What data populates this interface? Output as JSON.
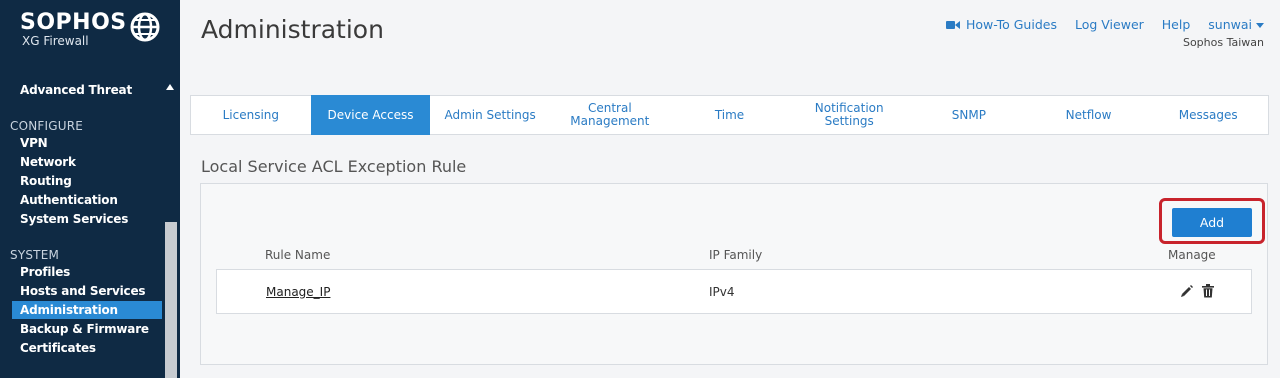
{
  "brand": {
    "name": "SOPHOS",
    "product": "XG Firewall"
  },
  "sidebar": {
    "top_item": "Advanced Threat",
    "groups": [
      {
        "label": "CONFIGURE",
        "items": [
          "VPN",
          "Network",
          "Routing",
          "Authentication",
          "System Services"
        ]
      },
      {
        "label": "SYSTEM",
        "items": [
          "Profiles",
          "Hosts and Services",
          "Administration",
          "Backup & Firmware",
          "Certificates"
        ]
      }
    ],
    "active_item": "Administration"
  },
  "header": {
    "title": "Administration",
    "links": {
      "howto": "How-To Guides",
      "log_viewer": "Log Viewer",
      "help": "Help",
      "user": "sunwai"
    },
    "org": "Sophos Taiwan"
  },
  "tabs": [
    {
      "label": "Licensing",
      "active": false
    },
    {
      "label": "Device Access",
      "active": true
    },
    {
      "label": "Admin Settings",
      "active": false
    },
    {
      "label": "Central Management",
      "active": false
    },
    {
      "label": "Time",
      "active": false
    },
    {
      "label": "Notification Settings",
      "active": false
    },
    {
      "label": "SNMP",
      "active": false
    },
    {
      "label": "Netflow",
      "active": false
    },
    {
      "label": "Messages",
      "active": false
    }
  ],
  "section": {
    "title": "Local Service ACL Exception Rule",
    "add_label": "Add",
    "columns": {
      "rule_name": "Rule Name",
      "ip_family": "IP Family",
      "manage": "Manage"
    },
    "rows": [
      {
        "rule_name": "Manage_IP",
        "ip_family": "IPv4"
      }
    ]
  },
  "colors": {
    "sidebar_bg": "#0f2a44",
    "accent": "#2a8ad4",
    "highlight": "#c8232c"
  }
}
